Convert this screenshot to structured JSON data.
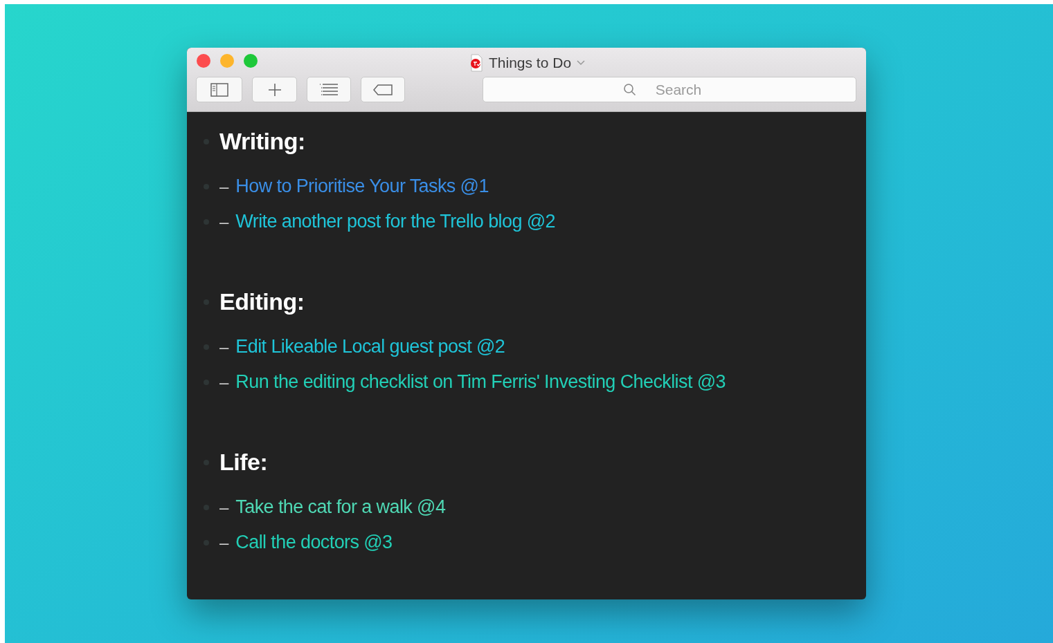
{
  "window": {
    "title": "Things to Do"
  },
  "toolbar": {
    "search": {
      "placeholder": "Search"
    }
  },
  "sections": [
    {
      "heading": "Writing:",
      "items": [
        {
          "dash": "–",
          "text": "How to Prioritise Your Tasks @1",
          "color": "#3a8ee6"
        },
        {
          "dash": "–",
          "text": "Write another post for the Trello blog @2",
          "color": "#1fc4d8"
        }
      ]
    },
    {
      "heading": "Editing:",
      "items": [
        {
          "dash": "–",
          "text": "Edit Likeable Local guest post @2",
          "color": "#1fc4d8"
        },
        {
          "dash": "–",
          "text": "Run the editing checklist on Tim Ferris' Investing Checklist @3",
          "color": "#22cfb6"
        }
      ]
    },
    {
      "heading": "Life:",
      "items": [
        {
          "dash": "–",
          "text": "Take the cat for a walk @4",
          "color": "#4fd8b4"
        },
        {
          "dash": "–",
          "text": "Call the doctors @3",
          "color": "#22cfb6"
        }
      ]
    }
  ]
}
